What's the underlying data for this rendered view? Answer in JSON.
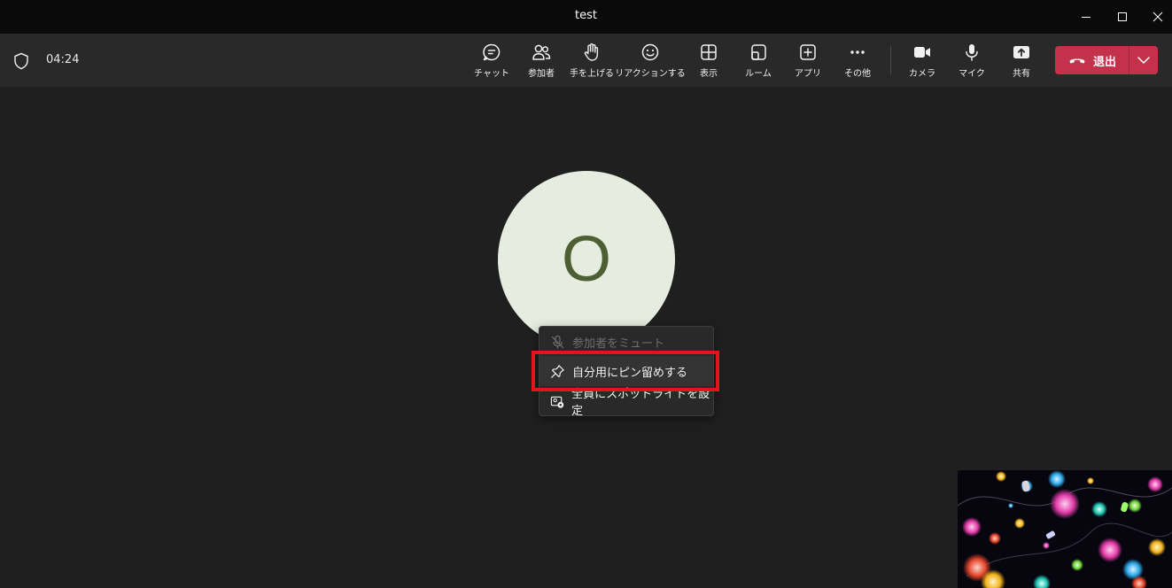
{
  "window": {
    "title": "test"
  },
  "meeting": {
    "timer": "04:24"
  },
  "toolbar": {
    "items": [
      {
        "label": "チャット",
        "icon": "chat-icon"
      },
      {
        "label": "参加者",
        "icon": "people-icon"
      },
      {
        "label": "手を上げる",
        "icon": "hand-icon"
      },
      {
        "label": "リアクションする",
        "icon": "smile-icon"
      },
      {
        "label": "表示",
        "icon": "grid-view-icon"
      },
      {
        "label": "ルーム",
        "icon": "rooms-icon"
      },
      {
        "label": "アプリ",
        "icon": "add-app-icon"
      },
      {
        "label": "その他",
        "icon": "more-icon"
      },
      {
        "label": "カメラ",
        "icon": "camera-icon"
      },
      {
        "label": "マイク",
        "icon": "mic-icon"
      },
      {
        "label": "共有",
        "icon": "share-icon"
      }
    ],
    "leave_label": "退出"
  },
  "participant": {
    "initial": "O",
    "avatar_color": "#e6ecdf",
    "initial_color": "#4d5f33"
  },
  "context_menu": {
    "items": [
      {
        "label": "参加者をミュート",
        "icon": "mic-off-icon",
        "disabled": true
      },
      {
        "label": "自分用にピン留めする",
        "icon": "pin-icon",
        "highlighted": true
      },
      {
        "label": "全員にスポットライトを設定",
        "icon": "spotlight-icon"
      }
    ]
  },
  "colors": {
    "leave_button": "#c4314b",
    "highlight_border": "#e3141e",
    "background": "#1f1f1f"
  }
}
